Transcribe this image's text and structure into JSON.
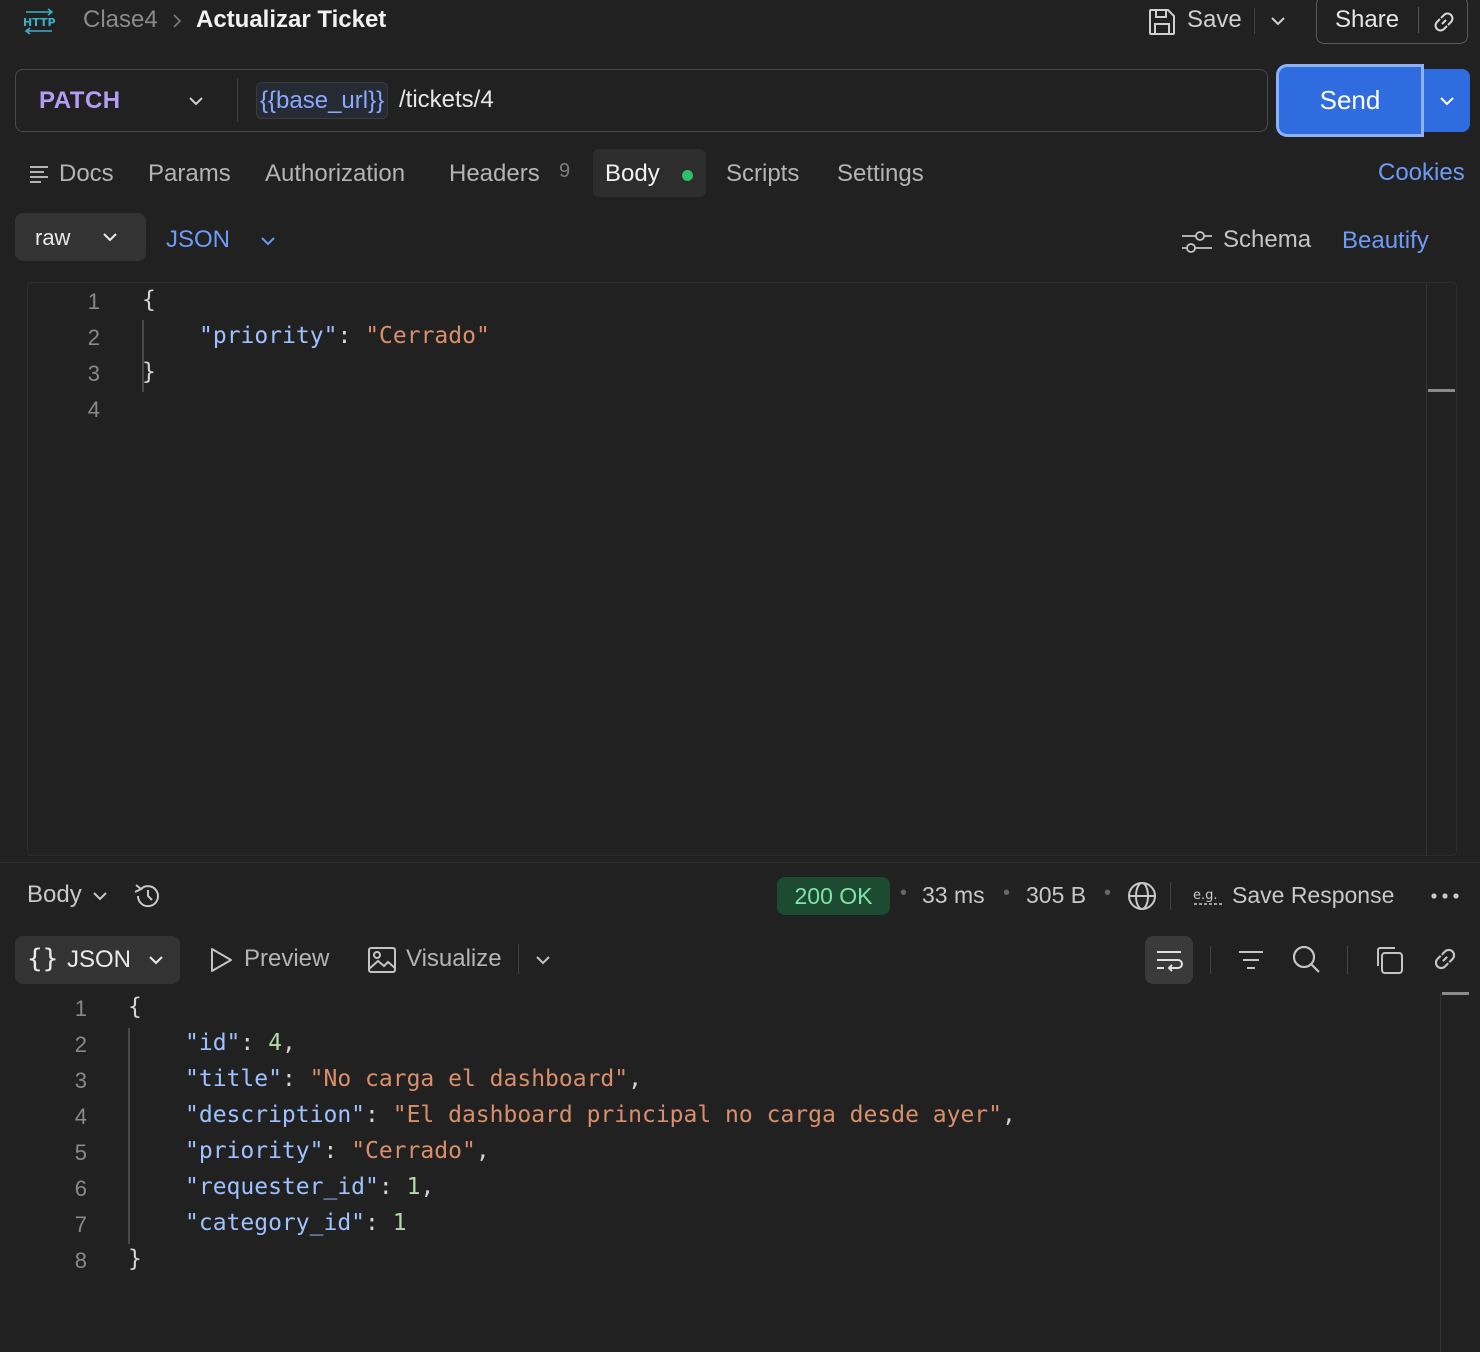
{
  "header": {
    "icon": "http-icon",
    "icon_text": "HTTP",
    "breadcrumb_parent": "Clase4",
    "title": "Actualizar Ticket",
    "save_label": "Save",
    "share_label": "Share"
  },
  "request": {
    "method": "PATCH",
    "url_variable": "{{base_url}}",
    "url_path": "/tickets/4",
    "send_label": "Send"
  },
  "tabs": [
    {
      "label": "Docs"
    },
    {
      "label": "Params"
    },
    {
      "label": "Authorization"
    },
    {
      "label": "Headers",
      "count": "9"
    },
    {
      "label": "Body",
      "active": true
    },
    {
      "label": "Scripts"
    },
    {
      "label": "Settings"
    }
  ],
  "cookies_label": "Cookies",
  "body_toolbar": {
    "mode": "raw",
    "format": "JSON",
    "schema_label": "Schema",
    "beautify_label": "Beautify"
  },
  "request_body": {
    "line_numbers": [
      "1",
      "2",
      "3",
      "4"
    ],
    "lines": [
      {
        "indent": 0,
        "tokens": [
          {
            "t": "{",
            "c": "punct"
          }
        ]
      },
      {
        "indent": 1,
        "tokens": [
          {
            "t": "\"priority\"",
            "c": "key"
          },
          {
            "t": ": ",
            "c": "punct"
          },
          {
            "t": "\"Cerrado\"",
            "c": "str"
          }
        ]
      },
      {
        "indent": 0,
        "tokens": [
          {
            "t": "}",
            "c": "punct"
          }
        ]
      },
      {
        "indent": 0,
        "tokens": []
      }
    ]
  },
  "response": {
    "body_label": "Body",
    "status": "200 OK",
    "time": "33 ms",
    "size": "305 B",
    "save_response_label": "Save Response",
    "format": "JSON",
    "preview_label": "Preview",
    "visualize_label": "Visualize",
    "line_numbers": [
      "1",
      "2",
      "3",
      "4",
      "5",
      "6",
      "7",
      "8"
    ],
    "lines": [
      {
        "indent": 0,
        "tokens": [
          {
            "t": "{",
            "c": "punct"
          }
        ]
      },
      {
        "indent": 1,
        "tokens": [
          {
            "t": "\"id\"",
            "c": "key"
          },
          {
            "t": ": ",
            "c": "punct"
          },
          {
            "t": "4",
            "c": "num"
          },
          {
            "t": ",",
            "c": "punct"
          }
        ]
      },
      {
        "indent": 1,
        "tokens": [
          {
            "t": "\"title\"",
            "c": "key"
          },
          {
            "t": ": ",
            "c": "punct"
          },
          {
            "t": "\"No carga el dashboard\"",
            "c": "str"
          },
          {
            "t": ",",
            "c": "punct"
          }
        ]
      },
      {
        "indent": 1,
        "tokens": [
          {
            "t": "\"description\"",
            "c": "key"
          },
          {
            "t": ": ",
            "c": "punct"
          },
          {
            "t": "\"El dashboard principal no carga desde ayer\"",
            "c": "str"
          },
          {
            "t": ",",
            "c": "punct"
          }
        ]
      },
      {
        "indent": 1,
        "tokens": [
          {
            "t": "\"priority\"",
            "c": "key"
          },
          {
            "t": ": ",
            "c": "punct"
          },
          {
            "t": "\"Cerrado\"",
            "c": "str"
          },
          {
            "t": ",",
            "c": "punct"
          }
        ]
      },
      {
        "indent": 1,
        "tokens": [
          {
            "t": "\"requester_id\"",
            "c": "key"
          },
          {
            "t": ": ",
            "c": "punct"
          },
          {
            "t": "1",
            "c": "num"
          },
          {
            "t": ",",
            "c": "punct"
          }
        ]
      },
      {
        "indent": 1,
        "tokens": [
          {
            "t": "\"category_id\"",
            "c": "key"
          },
          {
            "t": ": ",
            "c": "punct"
          },
          {
            "t": "1",
            "c": "num"
          }
        ]
      },
      {
        "indent": 0,
        "tokens": [
          {
            "t": "}",
            "c": "punct"
          }
        ]
      }
    ]
  },
  "colors": {
    "accent_blue": "#2f6ce0",
    "method_purple": "#b49cf5",
    "status_green": "#7fe3a7",
    "body_dot_green": "#2fbf6a",
    "json_key": "#9ec1ff",
    "json_string": "#d98f6b",
    "json_number": "#b4d9a8"
  }
}
